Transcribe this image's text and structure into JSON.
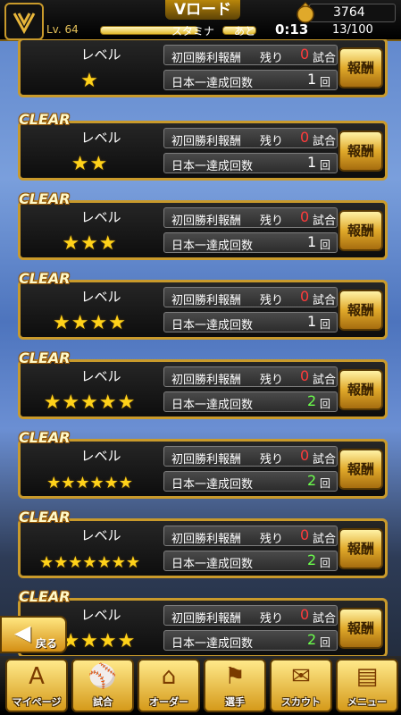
{
  "header": {
    "title": "Vロード",
    "coins": "3764",
    "level": "Lv. 64",
    "stamina_label": "スタミナ",
    "ato_label": "あと",
    "timer": "0:13",
    "stamina_count": "13/100"
  },
  "cards": [
    {
      "clear": "",
      "level_label": "レベル",
      "stars": "★",
      "first_win_label": "初回勝利報酬",
      "remaining_label": "残り",
      "remaining_num": "0",
      "remaining_unit": "試合",
      "japan_label": "日本一達成回数",
      "japan_count": "1",
      "japan_unit": "回",
      "reward": "報酬"
    },
    {
      "clear": "CLEAR",
      "level_label": "レベル",
      "stars": "★★",
      "first_win_label": "初回勝利報酬",
      "remaining_label": "残り",
      "remaining_num": "0",
      "remaining_unit": "試合",
      "japan_label": "日本一達成回数",
      "japan_count": "1",
      "japan_unit": "回",
      "reward": "報酬"
    },
    {
      "clear": "CLEAR",
      "level_label": "レベル",
      "stars": "★★★",
      "first_win_label": "初回勝利報酬",
      "remaining_label": "残り",
      "remaining_num": "0",
      "remaining_unit": "試合",
      "japan_label": "日本一達成回数",
      "japan_count": "1",
      "japan_unit": "回",
      "reward": "報酬"
    },
    {
      "clear": "CLEAR",
      "level_label": "レベル",
      "stars": "★★★★",
      "first_win_label": "初回勝利報酬",
      "remaining_label": "残り",
      "remaining_num": "0",
      "remaining_unit": "試合",
      "japan_label": "日本一達成回数",
      "japan_count": "1",
      "japan_unit": "回",
      "reward": "報酬"
    },
    {
      "clear": "CLEAR",
      "level_label": "レベル",
      "stars": "★★★★★",
      "first_win_label": "初回勝利報酬",
      "remaining_label": "残り",
      "remaining_num": "0",
      "remaining_unit": "試合",
      "japan_label": "日本一達成回数",
      "japan_count": "2",
      "japan_unit": "回",
      "reward": "報酬"
    },
    {
      "clear": "CLEAR",
      "level_label": "レベル",
      "stars": "★★★★★★",
      "first_win_label": "初回勝利報酬",
      "remaining_label": "残り",
      "remaining_num": "0",
      "remaining_unit": "試合",
      "japan_label": "日本一達成回数",
      "japan_count": "2",
      "japan_unit": "回",
      "reward": "報酬"
    },
    {
      "clear": "CLEAR",
      "level_label": "レベル",
      "stars": "★★★★★★★",
      "first_win_label": "初回勝利報酬",
      "remaining_label": "残り",
      "remaining_num": "0",
      "remaining_unit": "試合",
      "japan_label": "日本一達成回数",
      "japan_count": "2",
      "japan_unit": "回",
      "reward": "報酬"
    },
    {
      "clear": "CLEAR",
      "level_label": "レベル",
      "stars": "★★★★★",
      "first_win_label": "初回勝利報酬",
      "remaining_label": "残り",
      "remaining_num": "0",
      "remaining_unit": "試合",
      "japan_label": "日本一達成回数",
      "japan_count": "2",
      "japan_unit": "回",
      "reward": "報酬"
    }
  ],
  "back_label": "戻る",
  "nav": [
    {
      "label": "マイページ",
      "icon": "A"
    },
    {
      "label": "試合",
      "icon": "⚾"
    },
    {
      "label": "オーダー",
      "icon": "⌂"
    },
    {
      "label": "選手",
      "icon": "⚑"
    },
    {
      "label": "スカウト",
      "icon": "✉"
    },
    {
      "label": "メニュー",
      "icon": "▤"
    }
  ]
}
